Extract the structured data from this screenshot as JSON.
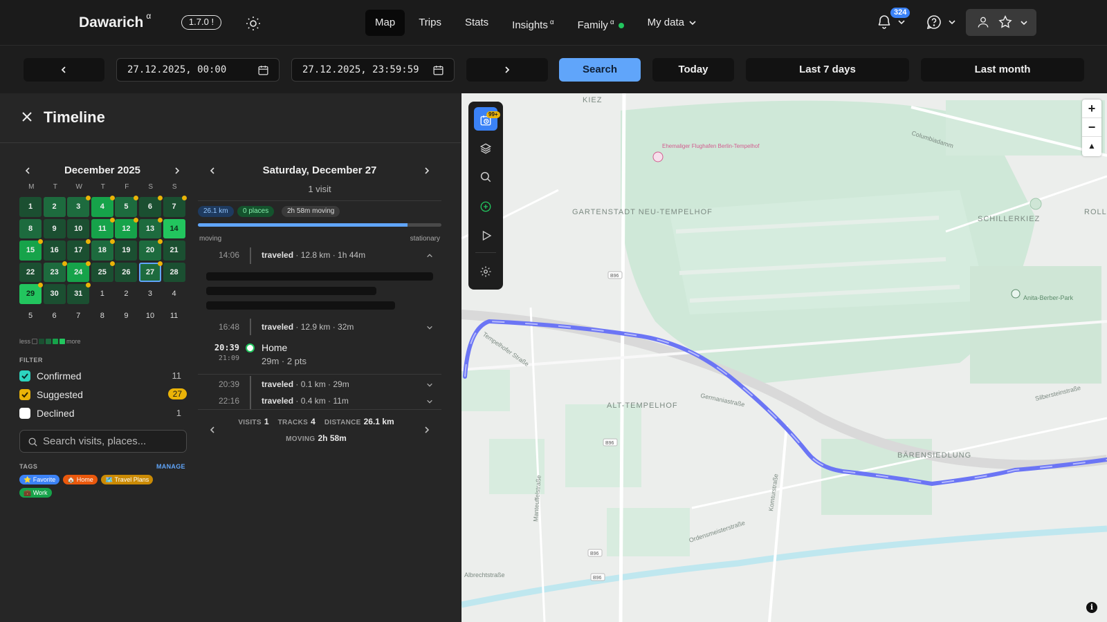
{
  "app": {
    "name": "Dawarich",
    "alpha": "α",
    "version": "1.7.0 !"
  },
  "nav": {
    "items": [
      {
        "label": "Map",
        "active": true
      },
      {
        "label": "Trips"
      },
      {
        "label": "Stats"
      },
      {
        "label": "Insights",
        "sup": "α"
      },
      {
        "label": "Family",
        "sup": "α",
        "status": "online"
      },
      {
        "label": "My data",
        "dropdown": true
      }
    ],
    "notifications_count": "324"
  },
  "datebar": {
    "start": "27.12.2025, 00:00",
    "end": "27.12.2025, 23:59:59",
    "search_label": "Search",
    "today_label": "Today",
    "last7_label": "Last 7 days",
    "last_month_label": "Last month"
  },
  "timeline": {
    "title": "Timeline",
    "calendar": {
      "month": "December 2025",
      "weekdays": [
        "M",
        "T",
        "W",
        "T",
        "F",
        "S",
        "S"
      ],
      "weeks": [
        [
          {
            "d": "1",
            "l": 1
          },
          {
            "d": "2",
            "l": 2
          },
          {
            "d": "3",
            "l": 2,
            "s": true
          },
          {
            "d": "4",
            "l": 3,
            "s": true
          },
          {
            "d": "5",
            "l": 2,
            "s": true
          },
          {
            "d": "6",
            "l": 1,
            "s": true
          },
          {
            "d": "7",
            "l": 1,
            "s": true
          }
        ],
        [
          {
            "d": "8",
            "l": 2
          },
          {
            "d": "9",
            "l": 1
          },
          {
            "d": "10",
            "l": 1
          },
          {
            "d": "11",
            "l": 3,
            "s": true
          },
          {
            "d": "12",
            "l": 3,
            "s": true
          },
          {
            "d": "13",
            "l": 2,
            "s": true
          },
          {
            "d": "14",
            "l": 4
          }
        ],
        [
          {
            "d": "15",
            "l": 3,
            "s": true
          },
          {
            "d": "16",
            "l": 1
          },
          {
            "d": "17",
            "l": 1,
            "s": true
          },
          {
            "d": "18",
            "l": 2,
            "s": true
          },
          {
            "d": "19",
            "l": 1
          },
          {
            "d": "20",
            "l": 2,
            "s": true
          },
          {
            "d": "21",
            "l": 1
          }
        ],
        [
          {
            "d": "22",
            "l": 1
          },
          {
            "d": "23",
            "l": 2,
            "s": true
          },
          {
            "d": "24",
            "l": 3,
            "s": true
          },
          {
            "d": "25",
            "l": 1,
            "s": true
          },
          {
            "d": "26",
            "l": 1
          },
          {
            "d": "27",
            "l": 2,
            "s": true,
            "selected": true
          },
          {
            "d": "28",
            "l": 1
          }
        ],
        [
          {
            "d": "29",
            "l": 4,
            "s": true
          },
          {
            "d": "30",
            "l": 1
          },
          {
            "d": "31",
            "l": 1,
            "s": true
          },
          {
            "d": "1",
            "l": 0
          },
          {
            "d": "2",
            "l": 0
          },
          {
            "d": "3",
            "l": 0
          },
          {
            "d": "4",
            "l": 0
          }
        ],
        [
          {
            "d": "5",
            "l": 0
          },
          {
            "d": "6",
            "l": 0
          },
          {
            "d": "7",
            "l": 0
          },
          {
            "d": "8",
            "l": 0
          },
          {
            "d": "9",
            "l": 0
          },
          {
            "d": "10",
            "l": 0
          },
          {
            "d": "11",
            "l": 0
          }
        ]
      ]
    },
    "legend": {
      "less": "less",
      "more": "more"
    },
    "filter": {
      "heading": "FILTER",
      "items": [
        {
          "label": "Confirmed",
          "count": "11",
          "color": "#22c55e",
          "checked": true
        },
        {
          "label": "Suggested",
          "count": "27",
          "color": "#eab308",
          "checked": true
        },
        {
          "label": "Declined",
          "count": "1",
          "color": "#ffffff",
          "checked": false
        }
      ]
    },
    "search_placeholder": "Search visits, places...",
    "tags": {
      "heading": "TAGS",
      "manage": "MANAGE",
      "items": [
        {
          "label": "⭐ Favorite",
          "color": "#3b82f6"
        },
        {
          "label": "🏠 Home",
          "color": "#ea580c"
        },
        {
          "label": "🗺️ Travel Plans",
          "color": "#ca8a04"
        },
        {
          "label": "💼 Work",
          "color": "#16a34a"
        }
      ]
    },
    "day": {
      "title": "Saturday, December 27",
      "visits": "1 visit",
      "pills": [
        "26.1 km",
        "0 places",
        "2h 58m moving"
      ],
      "moving_fraction": 0.86,
      "moving_label": "moving",
      "stationary_label": "stationary",
      "entries": [
        {
          "time": "14:06",
          "kind": "traveled",
          "detail": " · 12.8 km · 1h 44m"
        },
        {
          "time": "16:48",
          "kind": "traveled",
          "detail": " · 12.9 km · 32m"
        },
        {
          "time": "20:39",
          "time2": "21:09",
          "place": "Home",
          "detail": "29m · 2 pts"
        },
        {
          "time": "20:39",
          "kind": "traveled",
          "detail": " · 0.1 km · 29m"
        },
        {
          "time": "22:16",
          "kind": "traveled",
          "detail": " · 0.4 km · 11m"
        }
      ],
      "summary": {
        "visits_label": "VISITS",
        "visits": "1",
        "tracks_label": "TRACKS",
        "tracks": "4",
        "distance_label": "DISTANCE",
        "distance": "26.1 km",
        "moving_label": "MOVING",
        "moving": "2h 58m"
      }
    }
  },
  "map": {
    "toolbar_badge": "99+",
    "labels": {
      "kiez": "KIEZ",
      "flughafen": "Ehemaliger Flughafen Berlin-Tempelhof",
      "gartenstadt": "GARTENSTADT NEU-TEMPELHOF",
      "columbiadamm": "Columbiadamm",
      "schillerkiez": "SCHILLERKIEZ",
      "rolle": "ROLLE",
      "anita": "Anita-Berber-Park",
      "tempelhof": "ALT-TEMPELHOF",
      "germaniastrasse": "Germaniastraße",
      "silberstein": "Silbersteinstraße",
      "baren": "BÄRENSIEDLUNG",
      "tempelhofer": "Tempelhofer Straße",
      "ordensmeister": "Ordensmeisterstraße",
      "komturstrasse": "Komturstraße",
      "manteuffel": "Manteuffelstraße",
      "albrecht": "Albrechtstraße",
      "b96": "B96"
    }
  }
}
